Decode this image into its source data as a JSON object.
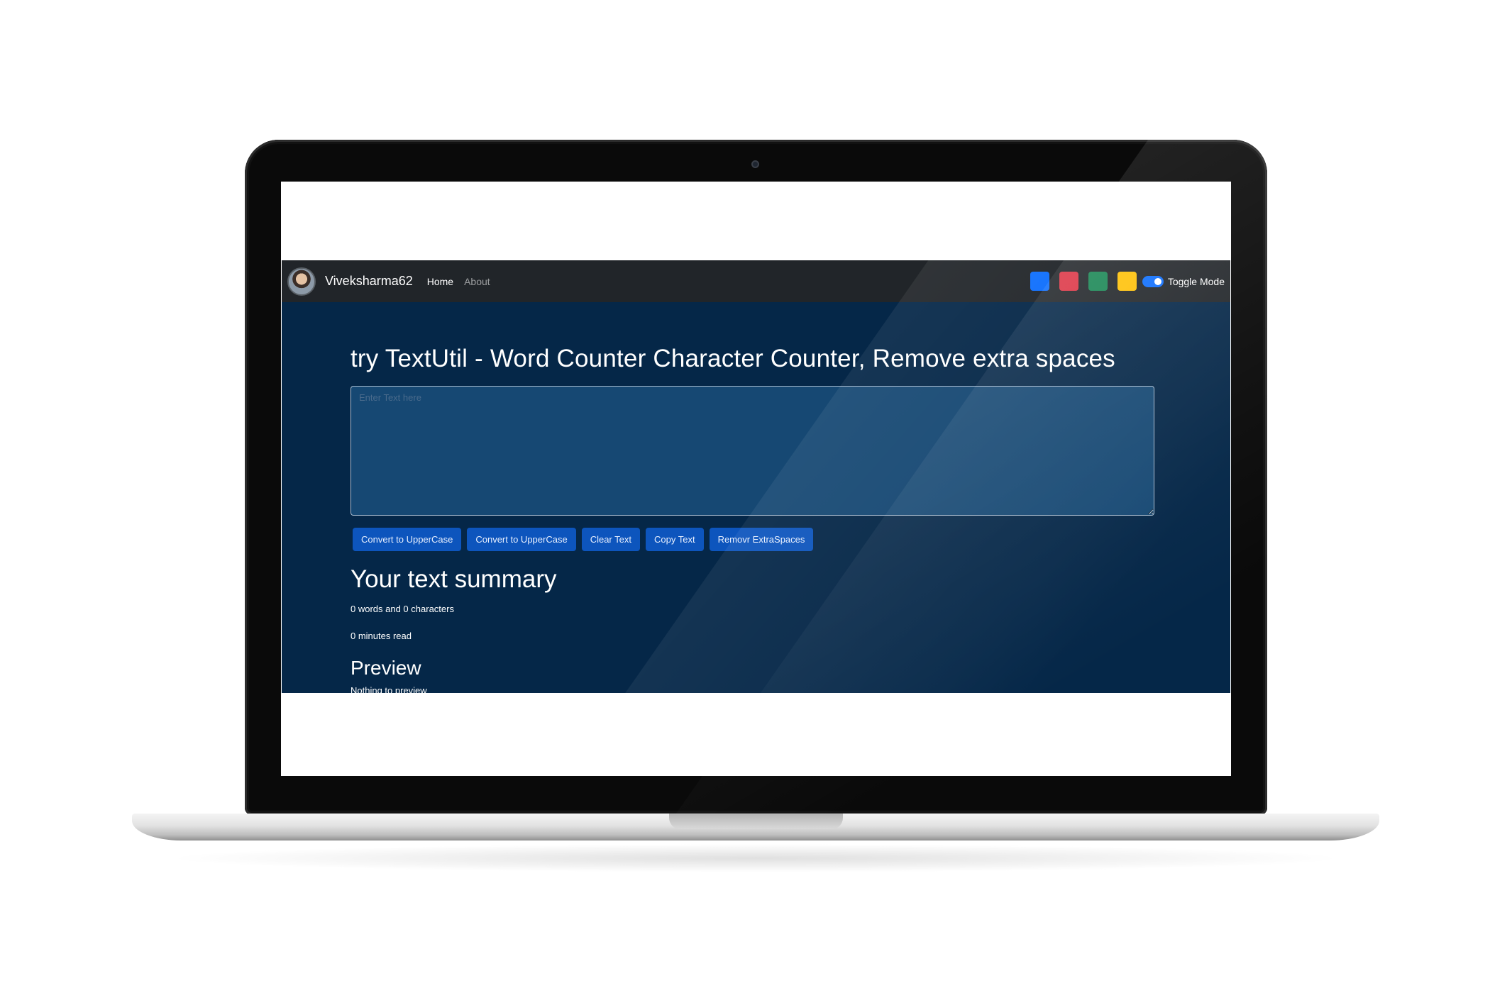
{
  "navbar": {
    "brand": "Viveksharma62",
    "links": [
      {
        "label": "Home",
        "active": true
      },
      {
        "label": "About",
        "active": false
      }
    ],
    "theme_swatches": [
      {
        "name": "blue",
        "color": "#0d6efd"
      },
      {
        "name": "red",
        "color": "#dc3545"
      },
      {
        "name": "green",
        "color": "#198754"
      },
      {
        "name": "yellow",
        "color": "#ffc107"
      }
    ],
    "toggle_label": "Toggle Mode",
    "toggle_on": true
  },
  "main": {
    "headline": "try TextUtil - Word Counter Character Counter, Remove extra spaces",
    "textarea_placeholder": "Enter Text here",
    "textarea_value": "",
    "buttons": [
      "Convert to UpperCase",
      "Convert to UpperCase",
      "Clear Text",
      "Copy Text",
      "Removr ExtraSpaces"
    ]
  },
  "summary": {
    "title": "Your text summary",
    "counts": "0 words and 0 characters",
    "read_time": "0 minutes read"
  },
  "preview": {
    "title": "Preview",
    "text": "Nothing to preview"
  },
  "colors": {
    "app_background": "#052748",
    "navbar_background": "#212529",
    "button_background": "#0d55bd",
    "textarea_background": "#164873"
  }
}
